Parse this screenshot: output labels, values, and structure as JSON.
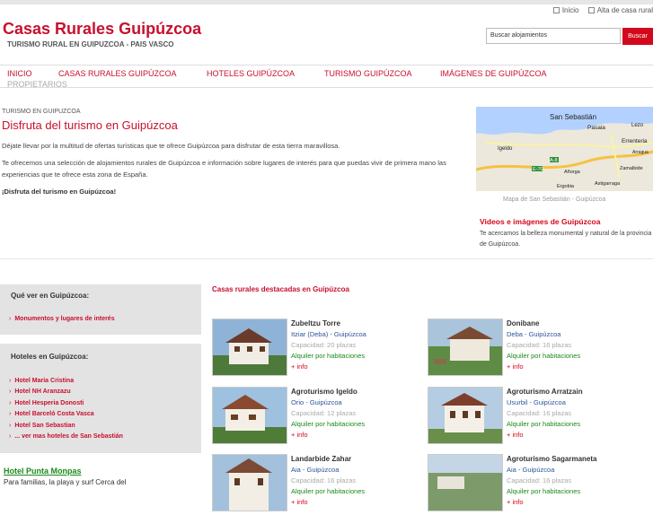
{
  "top_links": {
    "home": "Inicio",
    "add": "Alta de casa rural"
  },
  "site": {
    "title": "Casas Rurales Guipúzcoa",
    "subtitle": "TURISMO RURAL EN GUIPUZCOA - PAIS VASCO"
  },
  "search": {
    "value": "Buscar alojamientos",
    "button": "Buscar"
  },
  "nav": [
    "INICIO",
    "CASAS RURALES GUIPÚZCOA",
    "HOTELES GUIPÚZCOA",
    "TURISMO GUIPÚZCOA",
    "IMÁGENES DE GUIPÚZCOA",
    "PROPIETARIOS"
  ],
  "main": {
    "breadcrumb": "TURISMO EN GUIPUZCOA",
    "title": "Disfruta del turismo en Guipúzcoa",
    "p1": "Déjate llevar por la multitud de ofertas turísticas que te ofrece Guipúzcoa para disfrutar de esta tierra maravillosa.",
    "p2": "Te ofrecemos una selección de alojamientos rurales de Guipúzcoa e información sobre lugares de interés para que puedas vivir de primera mano las experiencias que te ofrece esta zona de España.",
    "p3": "¡Disfruta del turismo en Guipúzcoa!"
  },
  "map": {
    "caption": "Mapa de San Sebastián - Guipúzcoa",
    "labels": [
      "San Sebastián",
      "Pasaia",
      "Lezo",
      "Errenteria",
      "Igeldo",
      "A-8",
      "Zamalbide",
      "E-70",
      "Añorga",
      "Ergobia",
      "Astigarraga",
      "Arragua"
    ]
  },
  "videos": {
    "title": "Videos e imágenes de Guipúzcoa",
    "text": "Te acercamos la belleza monumental y natural de la provincia de Guipúzcoa."
  },
  "sidebar": {
    "see_title": "Qué ver en Guipúzcoa:",
    "see_items": [
      "Monumentos y lugares de interés"
    ],
    "hotels_title": "Hoteles en Guipúzcoa:",
    "hotels": [
      "Hotel Maria Cristina",
      "Hotel NH Aranzazu",
      "Hotel Hesperia Donosti",
      "Hotel Barceló Costa Vasca",
      "Hotel San Sebastian",
      "... ver mas hoteles de San Sebastián"
    ],
    "promo_name": "Hotel Punta Monpas",
    "promo_desc": "Para familias, la playa y surf Cerca del"
  },
  "featured": {
    "title": "Casas rurales destacadas en Guipúzcoa",
    "cards": [
      {
        "name": "Zubeltzu Torre",
        "location": "Itziar (Deba) - Guipúzcoa",
        "capacity": "Capacidad: 20 plazas",
        "rental": "Alquiler por habitaciones",
        "more": "+ info"
      },
      {
        "name": "Donibane",
        "location": "Deba - Guipúzcoa",
        "capacity": "Capacidad: 16 plazas",
        "rental": "Alquiler por habitaciones",
        "more": "+ info"
      },
      {
        "name": "Agroturismo Igeldo",
        "location": "Orio - Guipúzcoa",
        "capacity": "Capacidad: 12 plazas",
        "rental": "Alquiler por habitaciones",
        "more": "+ info"
      },
      {
        "name": "Agroturismo Arratzain",
        "location": "Usurbil - Guipúzcoa",
        "capacity": "Capacidad: 16 plazas",
        "rental": "Alquiler por habitaciones",
        "more": "+ info"
      },
      {
        "name": "Landarbide Zahar",
        "location": "Aia - Guipúzcoa",
        "capacity": "Capacidad: 16 plazas",
        "rental": "Alquiler por habitaciones",
        "more": "+ info"
      },
      {
        "name": "Agroturismo Sagarmaneta",
        "location": "Aia - Guipúzcoa",
        "capacity": "Capacidad: 16 plazas",
        "rental": "Alquiler por habitaciones",
        "more": "+ info"
      }
    ]
  }
}
